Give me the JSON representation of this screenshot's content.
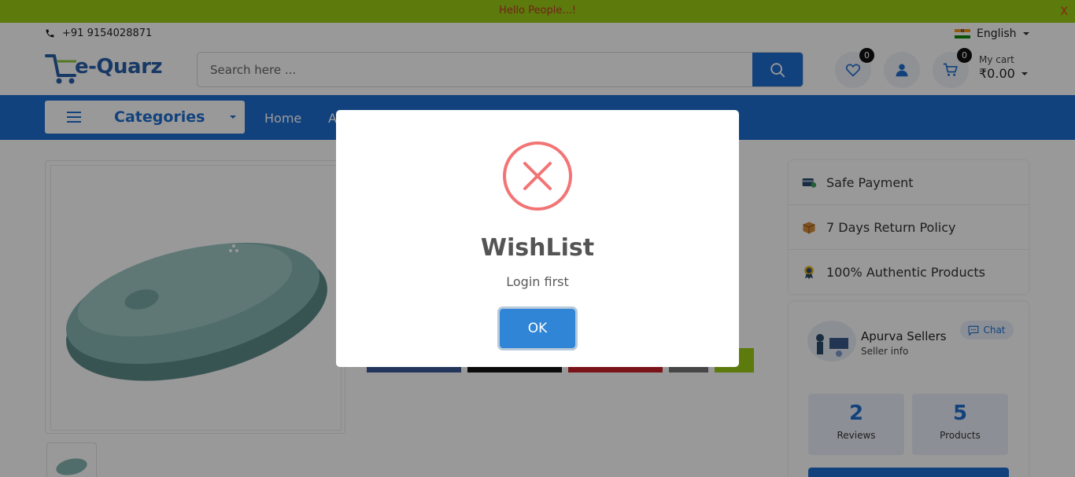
{
  "announcement": {
    "text": "Hello People...!",
    "close_label": "X"
  },
  "header": {
    "phone": "+91 9154028871",
    "language": "English",
    "brand": "e-Quarz",
    "search_placeholder": "Search here ...",
    "wishlist_count": "0",
    "cart_count": "0",
    "cart_label": "My cart",
    "cart_total": "₹0.00"
  },
  "nav": {
    "categories_label": "Categories",
    "links": [
      "Home",
      "A"
    ]
  },
  "features": [
    {
      "icon": "card-payment-icon",
      "label": "Safe Payment"
    },
    {
      "icon": "return-box-icon",
      "label": "7 Days Return Policy"
    },
    {
      "icon": "authentic-badge-icon",
      "label": "100% Authentic Products"
    }
  ],
  "seller": {
    "name": "Apurva Sellers",
    "subtitle": "Seller info",
    "chat_label": "Chat",
    "stats": [
      {
        "value": "2",
        "label": "Reviews"
      },
      {
        "value": "5",
        "label": "Products"
      }
    ]
  },
  "modal": {
    "title": "WishList",
    "message": "Login first",
    "ok_label": "OK"
  },
  "colors": {
    "primary": "#1f6fd0",
    "announcement_bg": "#9bcb17",
    "error": "#f27474",
    "confirm_button": "#3085d6"
  }
}
